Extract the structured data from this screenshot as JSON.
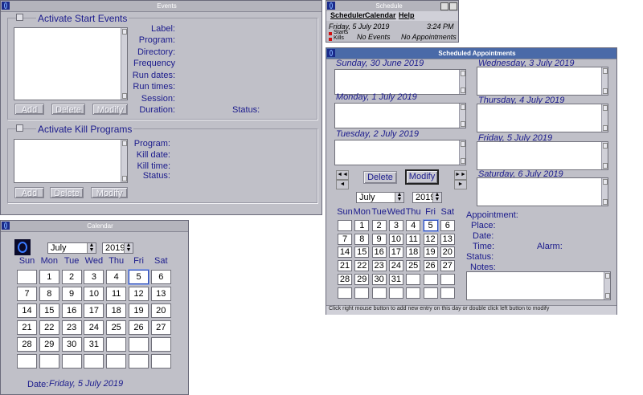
{
  "events": {
    "title": "Events",
    "activate_start_label": "Activate Start Events",
    "start_fields": [
      "Label:",
      "Program:",
      "Directory:",
      "Frequency",
      "Run dates:",
      "Run times:",
      "Session:",
      "Duration:"
    ],
    "status_label": "Status:",
    "buttons": {
      "add": "Add",
      "delete": "Delete",
      "modify": "Modify"
    },
    "activate_kill_label": "Activate Kill Programs",
    "kill_fields": [
      "Program:",
      "Kill date:",
      "Kill time:",
      "Status:"
    ]
  },
  "schedule": {
    "title": "Schedule",
    "menu": [
      "Scheduler",
      "Calendar",
      "Help"
    ],
    "date": "Friday, 5 July 2019",
    "time": "3:24 PM",
    "legend_starts": "Starts",
    "legend_kills": "Kills",
    "no_events": "No Events",
    "no_appointments": "No Appointments"
  },
  "appointments": {
    "title": "Scheduled Appointments",
    "days_left": [
      "Sunday, 30 June 2019",
      "Monday, 1 July 2019",
      "Tuesday, 2 July 2019"
    ],
    "days_right": [
      "Wednesday, 3 July 2019",
      "Thursday, 4 July 2019",
      "Friday, 5 July 2019",
      "Saturday, 6 July 2019"
    ],
    "delete_label": "Delete",
    "modify_label": "Modify",
    "nav_first": "◄◄",
    "nav_prev": "◄",
    "nav_next": "►",
    "nav_last": "►►",
    "month": "July",
    "year": "2019",
    "weekdays": [
      "Sun",
      "Mon",
      "Tue",
      "Wed",
      "Thu",
      "Fri",
      "Sat"
    ],
    "weeks": [
      [
        "",
        "1",
        "2",
        "3",
        "4",
        "5",
        "6"
      ],
      [
        "7",
        "8",
        "9",
        "10",
        "11",
        "12",
        "13"
      ],
      [
        "14",
        "15",
        "16",
        "17",
        "18",
        "19",
        "20"
      ],
      [
        "21",
        "22",
        "23",
        "24",
        "25",
        "26",
        "27"
      ],
      [
        "28",
        "29",
        "30",
        "31",
        "",
        "",
        ""
      ],
      [
        "",
        "",
        "",
        "",
        "",
        "",
        ""
      ]
    ],
    "selected_day": "5",
    "appointment_label": "Appointment:",
    "place_label": "Place:",
    "date_label": "Date:",
    "time_label": "Time:",
    "alarm_label": "Alarm:",
    "status_label": "Status:",
    "notes_label": "Notes:",
    "status_bar": "Click right mouse button to add new entry on this day or double click left button to modify"
  },
  "calendar": {
    "title": "Calendar",
    "month": "July",
    "year": "2019",
    "weekdays": [
      "Sun",
      "Mon",
      "Tue",
      "Wed",
      "Thu",
      "Fri",
      "Sat"
    ],
    "weeks": [
      [
        "",
        "1",
        "2",
        "3",
        "4",
        "5",
        "6"
      ],
      [
        "7",
        "8",
        "9",
        "10",
        "11",
        "12",
        "13"
      ],
      [
        "14",
        "15",
        "16",
        "17",
        "18",
        "19",
        "20"
      ],
      [
        "21",
        "22",
        "23",
        "24",
        "25",
        "26",
        "27"
      ],
      [
        "28",
        "29",
        "30",
        "31",
        "",
        "",
        ""
      ],
      [
        "",
        "",
        "",
        "",
        "",
        "",
        ""
      ]
    ],
    "selected_day": "5",
    "date_label": "Date:",
    "date_value": "Friday, 5 July 2019"
  },
  "colors": {
    "text": "#1a1a8c",
    "window_bg": "#c0c0c8",
    "active_title": "#4a6aa8"
  }
}
